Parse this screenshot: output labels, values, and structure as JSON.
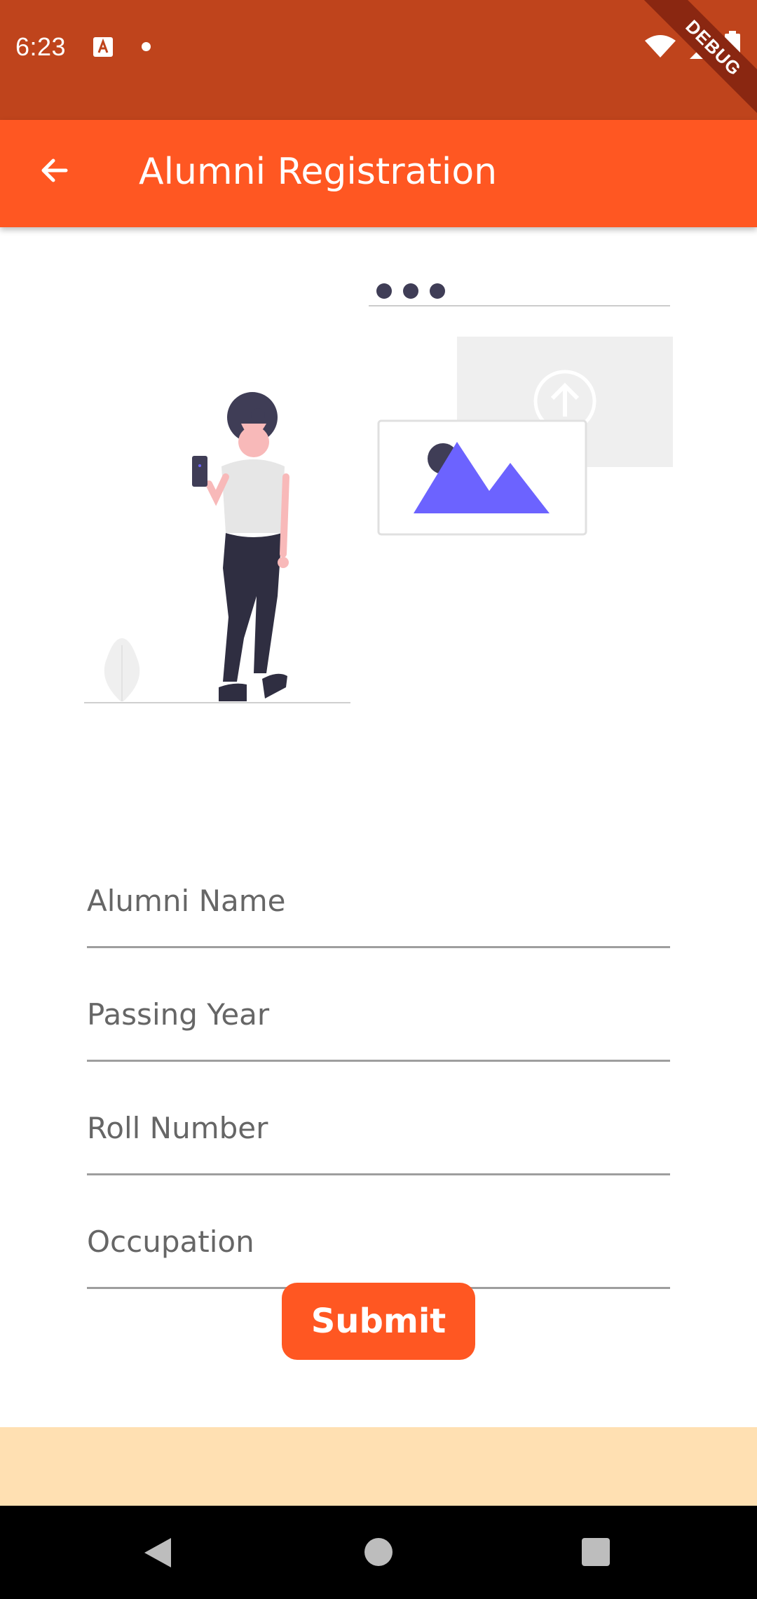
{
  "status_bar": {
    "time": "6:23",
    "debug_label": "DEBUG",
    "icons": [
      "keyboard-a-icon",
      "notification-dot-icon",
      "wifi-icon",
      "signal-icon",
      "battery-icon"
    ]
  },
  "app_bar": {
    "title": "Alumni Registration",
    "back_icon": "arrow-back-icon"
  },
  "form": {
    "fields": [
      {
        "placeholder": "Alumni Name",
        "value": ""
      },
      {
        "placeholder": "Passing Year",
        "value": ""
      },
      {
        "placeholder": "Roll Number",
        "value": ""
      },
      {
        "placeholder": "Occupation",
        "value": ""
      }
    ],
    "submit_label": "Submit"
  },
  "colors": {
    "status_bar": "#bf441c",
    "accent": "#ff5722",
    "footer_band": "#ffe0b2",
    "illustration_accent": "#6c63ff"
  },
  "nav_bar": {
    "icons": [
      "nav-back-icon",
      "nav-home-icon",
      "nav-recents-icon"
    ]
  }
}
